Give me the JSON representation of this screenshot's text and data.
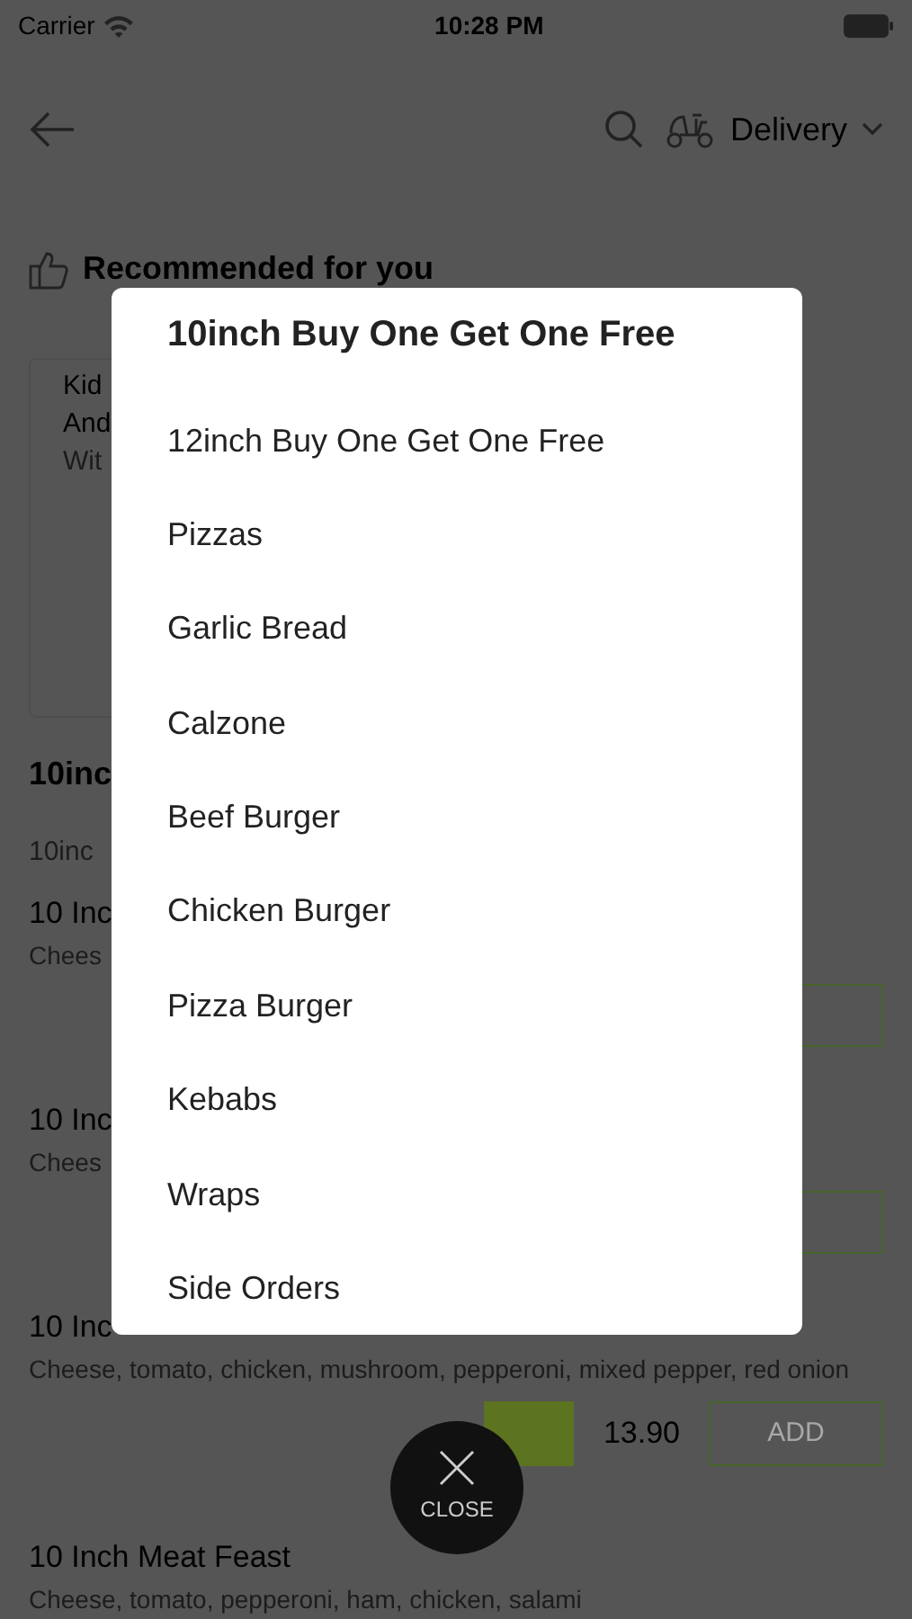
{
  "status_bar": {
    "carrier": "Carrier",
    "time": "10:28 PM"
  },
  "header": {
    "mode_label": "Delivery"
  },
  "recommended": {
    "title": "Recommended for you",
    "card_lines": [
      "Kid",
      "And",
      "Wit"
    ]
  },
  "menu": {
    "section_title": "10inc",
    "section_subtitle": "10inc",
    "items": [
      {
        "kind": "covered",
        "name": "10 Inc",
        "description": "Chees"
      },
      {
        "kind": "covered",
        "name": "10 Inc",
        "description": "Chees"
      },
      {
        "kind": "priced",
        "name": "10 Inc",
        "description": "Cheese, tomato, chicken, mushroom, pepperoni, mixed pepper, red onion",
        "price": "13.90",
        "add_label": "ADD"
      },
      {
        "kind": "cut",
        "name": "10 Inch Meat Feast",
        "description": "Cheese, tomato, pepperoni, ham, chicken, salami"
      }
    ]
  },
  "category_menu": {
    "items": [
      {
        "label": "10inch Buy One Get One Free",
        "selected": true
      },
      {
        "label": "12inch Buy One Get One Free",
        "selected": false
      },
      {
        "label": "Pizzas",
        "selected": false
      },
      {
        "label": "Garlic Bread",
        "selected": false
      },
      {
        "label": "Calzone",
        "selected": false
      },
      {
        "label": "Beef Burger",
        "selected": false
      },
      {
        "label": "Chicken Burger",
        "selected": false
      },
      {
        "label": "Pizza Burger",
        "selected": false
      },
      {
        "label": "Kebabs",
        "selected": false
      },
      {
        "label": "Wraps",
        "selected": false
      },
      {
        "label": "Side Orders",
        "selected": false
      }
    ]
  },
  "close_button": {
    "label": "CLOSE"
  }
}
